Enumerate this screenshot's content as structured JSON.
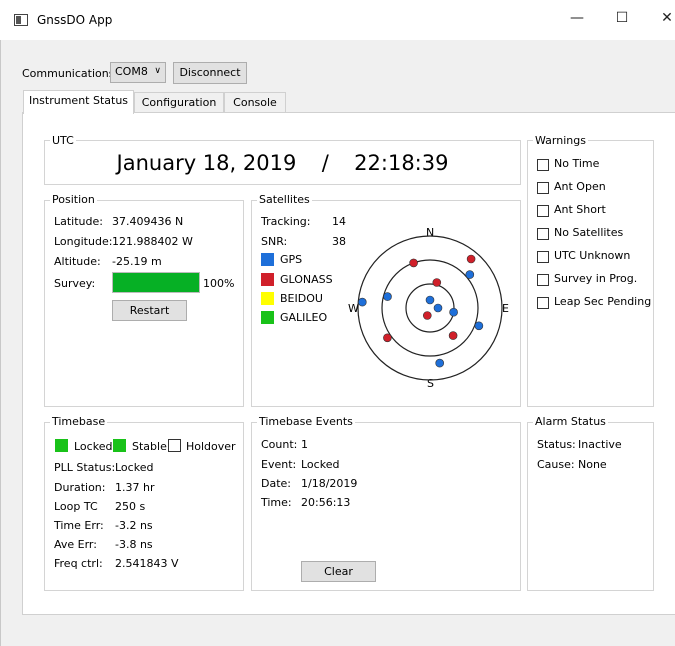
{
  "window": {
    "title": "GnssDO App",
    "minimize": "—",
    "maximize": "☐",
    "close": "✕"
  },
  "communications": {
    "label": "Communications:",
    "port": "COM8",
    "disconnect_label": "Disconnect"
  },
  "tabs": [
    {
      "label": "Instrument Status",
      "active": true
    },
    {
      "label": "Configuration",
      "active": false
    },
    {
      "label": "Console",
      "active": false
    }
  ],
  "utc": {
    "title": "UTC",
    "date": "January 18, 2019",
    "separator": "/",
    "time": "22:18:39"
  },
  "position": {
    "title": "Position",
    "latitude_label": "Latitude:",
    "latitude": "37.409436 N",
    "longitude_label": "Longitude:",
    "longitude": "121.988402 W",
    "altitude_label": "Altitude:",
    "altitude": "-25.19 m",
    "survey_label": "Survey:",
    "survey_percent": "100%",
    "survey_progress": 1.0,
    "restart_label": "Restart"
  },
  "satellites": {
    "title": "Satellites",
    "tracking_label": "Tracking:",
    "tracking": "14",
    "snr_label": "SNR:",
    "snr": "38",
    "legend": [
      {
        "name": "GPS",
        "color": "#1e6fd9"
      },
      {
        "name": "GLONASS",
        "color": "#d0202a"
      },
      {
        "name": "BEIDOU",
        "color": "#ffff00"
      },
      {
        "name": "GALILEO",
        "color": "#19c219"
      }
    ],
    "compass": {
      "n": "N",
      "e": "E",
      "s": "S",
      "w": "W"
    },
    "sky": [
      {
        "az": 340,
        "el": 30,
        "sys": "GLONASS"
      },
      {
        "az": 15,
        "el": 57,
        "sys": "GLONASS"
      },
      {
        "az": 40,
        "el": 10,
        "sys": "GLONASS"
      },
      {
        "az": 50,
        "el": 25,
        "sys": "GPS"
      },
      {
        "az": 285,
        "el": 35,
        "sys": "GPS"
      },
      {
        "az": 275,
        "el": 5,
        "sys": "GPS"
      },
      {
        "az": 235,
        "el": 25,
        "sys": "GLONASS"
      },
      {
        "az": 0,
        "el": 80,
        "sys": "GPS"
      },
      {
        "az": 90,
        "el": 80,
        "sys": "GPS"
      },
      {
        "az": 200,
        "el": 80,
        "sys": "GLONASS"
      },
      {
        "az": 100,
        "el": 60,
        "sys": "GPS"
      },
      {
        "az": 110,
        "el": 25,
        "sys": "GPS"
      },
      {
        "az": 140,
        "el": 45,
        "sys": "GLONASS"
      },
      {
        "az": 170,
        "el": 20,
        "sys": "GPS"
      }
    ]
  },
  "warnings": {
    "title": "Warnings",
    "items": [
      "No Time",
      "Ant Open",
      "Ant Short",
      "No Satellites",
      "UTC Unknown",
      "Survey in Prog.",
      "Leap Sec Pending"
    ]
  },
  "timebase": {
    "title": "Timebase",
    "locked_label": "Locked",
    "stable_label": "Stable",
    "holdover_label": "Holdover",
    "ok_color": "#19c219",
    "pll_label": "PLL Status:",
    "pll": "Locked",
    "duration_label": "Duration:",
    "duration": "1.37 hr",
    "looptc_label": "Loop TC",
    "looptc": "250 s",
    "timeerr_label": "Time Err:",
    "timeerr": "-3.2 ns",
    "aveerr_label": "Ave Err:",
    "aveerr": "-3.8 ns",
    "freq_label": "Freq ctrl:",
    "freq": "2.541843 V"
  },
  "events": {
    "title": "Timebase Events",
    "count_label": "Count:",
    "count": "1",
    "event_label": "Event:",
    "event": "Locked",
    "date_label": "Date:",
    "date": "1/18/2019",
    "time_label": "Time:",
    "time": "20:56:13",
    "clear_label": "Clear"
  },
  "alarm": {
    "title": "Alarm Status",
    "status_label": "Status:",
    "status": "Inactive",
    "cause_label": "Cause:",
    "cause": "None"
  }
}
